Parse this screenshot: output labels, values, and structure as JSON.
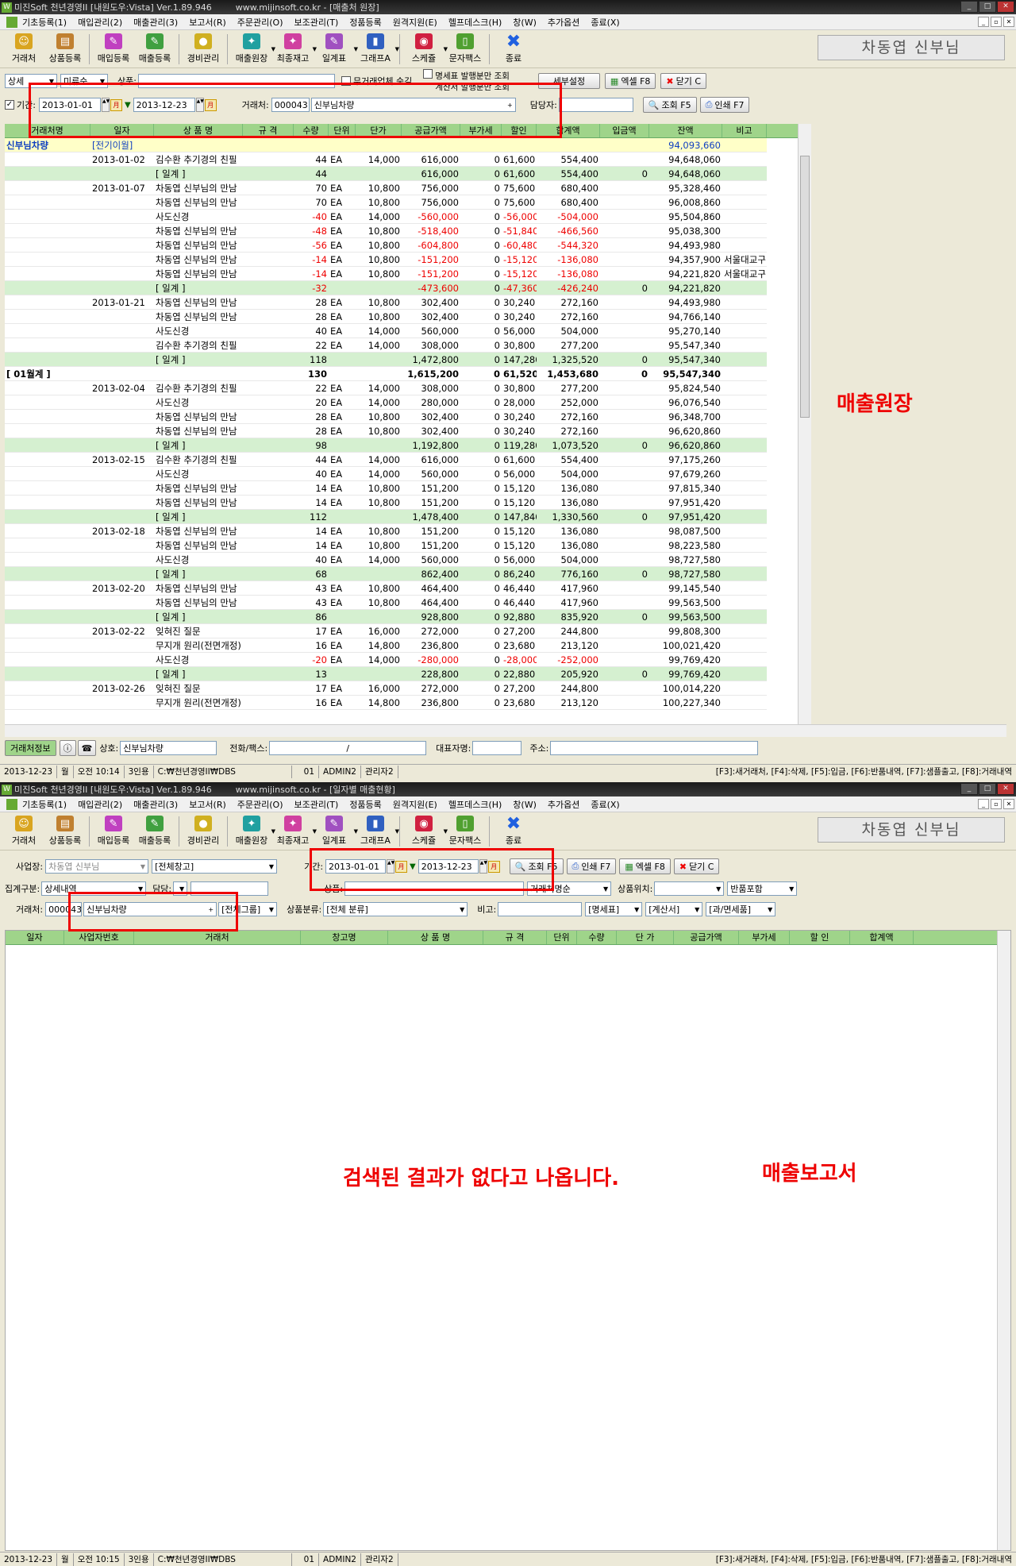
{
  "w1": {
    "title": "미진Soft 천년경영II [내원도우:Vista] Ver.1.89.946",
    "url": "www.mijinsoft.co.kr - [매출처 원장]",
    "menu": [
      "기초등록(1)",
      "매입관리(2)",
      "매출관리(3)",
      "보고서(R)",
      "주문관리(O)",
      "보조관리(T)",
      "정품등록",
      "원격지원(E)",
      "헬프데스크(H)",
      "창(W)",
      "추가옵션",
      "종료(X)"
    ],
    "toolbar": [
      "거래처",
      "상품등록",
      "매입등록",
      "매출등록",
      "경비관리",
      "매출원장",
      "최종재고",
      "일계표",
      "그래프A",
      "스케쥴",
      "문자팩스",
      "종료"
    ],
    "user": "차동엽 신부님",
    "row1": {
      "sel1": "상세",
      "sel2": "미류순",
      "product_label": "상품:",
      "cb1": "무거래업체 숨김",
      "cb2": "명세표 발행분만 조회",
      "cb3": "계산서 발행분만 조회",
      "btn_setup": "세부설정",
      "btn_excel": "엑셀 F8",
      "btn_close": "닫기 C"
    },
    "row2": {
      "period_label": "기간:",
      "date_from": "2013-01-01",
      "date_to": "2013-12-23",
      "client_label": "거래처:",
      "client_code": "000043",
      "client_name": "신부님차량",
      "manager_label": "담당자:",
      "btn_query": "조회 F5",
      "btn_print": "인쇄 F7"
    },
    "cols": [
      "거래처명",
      "일자",
      "상 품 명",
      "규 격",
      "수량",
      "단위",
      "단가",
      "공급가액",
      "부가세",
      "할인",
      "합계액",
      "입금액",
      "잔액",
      "비고"
    ],
    "rows": [
      {
        "k": "carry",
        "c": [
          "신부님차량",
          "[전기이월]",
          "",
          "",
          "",
          "",
          "",
          "",
          "",
          "",
          "",
          "",
          "94,093,660",
          ""
        ]
      },
      {
        "k": "",
        "c": [
          "",
          "2013-01-02",
          "김수환 추기경의 친필",
          "",
          "44",
          "EA",
          "14,000",
          "616,000",
          "0",
          "61,600",
          "554,400",
          "",
          "94,648,060",
          ""
        ]
      },
      {
        "k": "sub",
        "c": [
          "",
          "",
          "[ 일계 ]",
          "",
          "44",
          "",
          "",
          "616,000",
          "0",
          "61,600",
          "554,400",
          "0",
          "94,648,060",
          ""
        ]
      },
      {
        "k": "",
        "c": [
          "",
          "2013-01-07",
          "차동엽 신부님의 만남",
          "",
          "70",
          "EA",
          "10,800",
          "756,000",
          "0",
          "75,600",
          "680,400",
          "",
          "95,328,460",
          ""
        ]
      },
      {
        "k": "",
        "c": [
          "",
          "",
          "차동엽 신부님의 만남",
          "",
          "70",
          "EA",
          "10,800",
          "756,000",
          "0",
          "75,600",
          "680,400",
          "",
          "96,008,860",
          ""
        ]
      },
      {
        "k": "",
        "c": [
          "",
          "",
          "사도신경",
          "",
          "-40",
          "EA",
          "14,000",
          "-560,000",
          "0",
          "-56,000",
          "-504,000",
          "",
          "95,504,860",
          ""
        ]
      },
      {
        "k": "",
        "c": [
          "",
          "",
          "차동엽 신부님의 만남",
          "",
          "-48",
          "EA",
          "10,800",
          "-518,400",
          "0",
          "-51,840",
          "-466,560",
          "",
          "95,038,300",
          ""
        ]
      },
      {
        "k": "",
        "c": [
          "",
          "",
          "차동엽 신부님의 만남",
          "",
          "-56",
          "EA",
          "10,800",
          "-604,800",
          "0",
          "-60,480",
          "-544,320",
          "",
          "94,493,980",
          ""
        ]
      },
      {
        "k": "",
        "c": [
          "",
          "",
          "차동엽 신부님의 만남",
          "",
          "-14",
          "EA",
          "10,800",
          "-151,200",
          "0",
          "-15,120",
          "-136,080",
          "",
          "94,357,900",
          "서울대교구"
        ]
      },
      {
        "k": "",
        "c": [
          "",
          "",
          "차동엽 신부님의 만남",
          "",
          "-14",
          "EA",
          "10,800",
          "-151,200",
          "0",
          "-15,120",
          "-136,080",
          "",
          "94,221,820",
          "서울대교구"
        ]
      },
      {
        "k": "sub",
        "c": [
          "",
          "",
          "[ 일계 ]",
          "",
          "-32",
          "",
          "",
          "-473,600",
          "0",
          "-47,360",
          "-426,240",
          "0",
          "94,221,820",
          ""
        ]
      },
      {
        "k": "",
        "c": [
          "",
          "2013-01-21",
          "차동엽 신부님의 만남",
          "",
          "28",
          "EA",
          "10,800",
          "302,400",
          "0",
          "30,240",
          "272,160",
          "",
          "94,493,980",
          ""
        ]
      },
      {
        "k": "",
        "c": [
          "",
          "",
          "차동엽 신부님의 만남",
          "",
          "28",
          "EA",
          "10,800",
          "302,400",
          "0",
          "30,240",
          "272,160",
          "",
          "94,766,140",
          ""
        ]
      },
      {
        "k": "",
        "c": [
          "",
          "",
          "사도신경",
          "",
          "40",
          "EA",
          "14,000",
          "560,000",
          "0",
          "56,000",
          "504,000",
          "",
          "95,270,140",
          ""
        ]
      },
      {
        "k": "",
        "c": [
          "",
          "",
          "김수환 추기경의 친필",
          "",
          "22",
          "EA",
          "14,000",
          "308,000",
          "0",
          "30,800",
          "277,200",
          "",
          "95,547,340",
          ""
        ]
      },
      {
        "k": "sub",
        "c": [
          "",
          "",
          "[ 일계 ]",
          "",
          "118",
          "",
          "",
          "1,472,800",
          "0",
          "147,280",
          "1,325,520",
          "0",
          "95,547,340",
          ""
        ]
      },
      {
        "k": "month",
        "c": [
          "[ 01월계 ]",
          "",
          "",
          "",
          "130",
          "",
          "",
          "1,615,200",
          "0",
          "61,520",
          "1,453,680",
          "0",
          "95,547,340",
          ""
        ]
      },
      {
        "k": "",
        "c": [
          "",
          "2013-02-04",
          "김수환 추기경의 친필",
          "",
          "22",
          "EA",
          "14,000",
          "308,000",
          "0",
          "30,800",
          "277,200",
          "",
          "95,824,540",
          ""
        ]
      },
      {
        "k": "",
        "c": [
          "",
          "",
          "사도신경",
          "",
          "20",
          "EA",
          "14,000",
          "280,000",
          "0",
          "28,000",
          "252,000",
          "",
          "96,076,540",
          ""
        ]
      },
      {
        "k": "",
        "c": [
          "",
          "",
          "차동엽 신부님의 만남",
          "",
          "28",
          "EA",
          "10,800",
          "302,400",
          "0",
          "30,240",
          "272,160",
          "",
          "96,348,700",
          ""
        ]
      },
      {
        "k": "",
        "c": [
          "",
          "",
          "차동엽 신부님의 만남",
          "",
          "28",
          "EA",
          "10,800",
          "302,400",
          "0",
          "30,240",
          "272,160",
          "",
          "96,620,860",
          ""
        ]
      },
      {
        "k": "sub",
        "c": [
          "",
          "",
          "[ 일계 ]",
          "",
          "98",
          "",
          "",
          "1,192,800",
          "0",
          "119,280",
          "1,073,520",
          "0",
          "96,620,860",
          ""
        ]
      },
      {
        "k": "",
        "c": [
          "",
          "2013-02-15",
          "김수환 추기경의 친필",
          "",
          "44",
          "EA",
          "14,000",
          "616,000",
          "0",
          "61,600",
          "554,400",
          "",
          "97,175,260",
          ""
        ]
      },
      {
        "k": "",
        "c": [
          "",
          "",
          "사도신경",
          "",
          "40",
          "EA",
          "14,000",
          "560,000",
          "0",
          "56,000",
          "504,000",
          "",
          "97,679,260",
          ""
        ]
      },
      {
        "k": "",
        "c": [
          "",
          "",
          "차동엽 신부님의 만남",
          "",
          "14",
          "EA",
          "10,800",
          "151,200",
          "0",
          "15,120",
          "136,080",
          "",
          "97,815,340",
          ""
        ]
      },
      {
        "k": "",
        "c": [
          "",
          "",
          "차동엽 신부님의 만남",
          "",
          "14",
          "EA",
          "10,800",
          "151,200",
          "0",
          "15,120",
          "136,080",
          "",
          "97,951,420",
          ""
        ]
      },
      {
        "k": "sub",
        "c": [
          "",
          "",
          "[ 일계 ]",
          "",
          "112",
          "",
          "",
          "1,478,400",
          "0",
          "147,840",
          "1,330,560",
          "0",
          "97,951,420",
          ""
        ]
      },
      {
        "k": "",
        "c": [
          "",
          "2013-02-18",
          "차동엽 신부님의 만남",
          "",
          "14",
          "EA",
          "10,800",
          "151,200",
          "0",
          "15,120",
          "136,080",
          "",
          "98,087,500",
          ""
        ]
      },
      {
        "k": "",
        "c": [
          "",
          "",
          "차동엽 신부님의 만남",
          "",
          "14",
          "EA",
          "10,800",
          "151,200",
          "0",
          "15,120",
          "136,080",
          "",
          "98,223,580",
          ""
        ]
      },
      {
        "k": "",
        "c": [
          "",
          "",
          "사도신경",
          "",
          "40",
          "EA",
          "14,000",
          "560,000",
          "0",
          "56,000",
          "504,000",
          "",
          "98,727,580",
          ""
        ]
      },
      {
        "k": "sub",
        "c": [
          "",
          "",
          "[ 일계 ]",
          "",
          "68",
          "",
          "",
          "862,400",
          "0",
          "86,240",
          "776,160",
          "0",
          "98,727,580",
          ""
        ]
      },
      {
        "k": "",
        "c": [
          "",
          "2013-02-20",
          "차동엽 신부님의 만남",
          "",
          "43",
          "EA",
          "10,800",
          "464,400",
          "0",
          "46,440",
          "417,960",
          "",
          "99,145,540",
          ""
        ]
      },
      {
        "k": "",
        "c": [
          "",
          "",
          "차동엽 신부님의 만남",
          "",
          "43",
          "EA",
          "10,800",
          "464,400",
          "0",
          "46,440",
          "417,960",
          "",
          "99,563,500",
          ""
        ]
      },
      {
        "k": "sub",
        "c": [
          "",
          "",
          "[ 일계 ]",
          "",
          "86",
          "",
          "",
          "928,800",
          "0",
          "92,880",
          "835,920",
          "0",
          "99,563,500",
          ""
        ]
      },
      {
        "k": "",
        "c": [
          "",
          "2013-02-22",
          "잊혀진 질문",
          "",
          "17",
          "EA",
          "16,000",
          "272,000",
          "0",
          "27,200",
          "244,800",
          "",
          "99,808,300",
          ""
        ]
      },
      {
        "k": "",
        "c": [
          "",
          "",
          "무지개 원리(전면개정)",
          "",
          "16",
          "EA",
          "14,800",
          "236,800",
          "0",
          "23,680",
          "213,120",
          "",
          "100,021,420",
          ""
        ]
      },
      {
        "k": "",
        "c": [
          "",
          "",
          "사도신경",
          "",
          "-20",
          "EA",
          "14,000",
          "-280,000",
          "0",
          "-28,000",
          "-252,000",
          "",
          "99,769,420",
          ""
        ]
      },
      {
        "k": "sub",
        "c": [
          "",
          "",
          "[ 일계 ]",
          "",
          "13",
          "",
          "",
          "228,800",
          "0",
          "22,880",
          "205,920",
          "0",
          "99,769,420",
          ""
        ]
      },
      {
        "k": "",
        "c": [
          "",
          "2013-02-26",
          "잊혀진 질문",
          "",
          "17",
          "EA",
          "16,000",
          "272,000",
          "0",
          "27,200",
          "244,800",
          "",
          "100,014,220",
          ""
        ]
      },
      {
        "k": "",
        "c": [
          "",
          "",
          "무지개 원리(전면개정)",
          "",
          "16",
          "EA",
          "14,800",
          "236,800",
          "0",
          "23,680",
          "213,120",
          "",
          "100,227,340",
          ""
        ]
      }
    ],
    "bottom": {
      "tab": "거래처정보",
      "shop_label": "상호:",
      "shop": "신부님차량",
      "tel_label": "전화/팩스:",
      "tel_sep": "/",
      "ceo_label": "대표자명:",
      "addr_label": "주소:"
    },
    "status": [
      "2013-12-23",
      "월",
      "오전 10:14",
      "3인용",
      "C:₩천년경영II₩DBS",
      "01",
      "ADMIN2",
      "관리자2",
      "[F3]:새거래처, [F4]:삭제, [F5]:입금, [F6]:반품내역, [F7]:샘플출고, [F8]:거래내역"
    ],
    "annot": "매출원장"
  },
  "w2": {
    "title": "미진Soft 천년경영II [내원도우:Vista] Ver.1.89.946",
    "url": "www.mijinsoft.co.kr - [일자별 매출현황]",
    "user": "차동엽 신부님",
    "r1": {
      "biz_label": "사업장:",
      "biz": "차동엽 신부님",
      "store": "[전체창고]",
      "period_label": "기간:",
      "date_from": "2013-01-01",
      "date_to": "2013-12-23",
      "btn_query": "조회 F5",
      "btn_print": "인쇄 F7",
      "btn_excel": "엑셀 F8",
      "btn_close": "닫기 C"
    },
    "r2": {
      "agg_label": "집계구분:",
      "agg": "상세내역",
      "mgr_label": "담당:",
      "prod_label": "상품:",
      "sort": "거래처명순",
      "loc_label": "상품위치:",
      "ret": "반품포함"
    },
    "r3": {
      "client_label": "거래처:",
      "client_code": "000043",
      "client_name": "신부님차량",
      "group": "[전체그룹]",
      "cat_label": "상품분류:",
      "cat": "[전체 분류]",
      "note_label": "비고:",
      "f1": "[명세표]",
      "f2": "[계산서]",
      "f3": "[과/면세품]"
    },
    "cols": [
      "일자",
      "사업자번호",
      "거래처",
      "창고명",
      "상 품 명",
      "규 격",
      "단위",
      "수량",
      "단 가",
      "공급가액",
      "부가세",
      "할 인",
      "합계액"
    ],
    "status": [
      "2013-12-23",
      "월",
      "오전 10:15",
      "3인용",
      "C:₩천년경영II₩DBS",
      "01",
      "ADMIN2",
      "관리자2",
      "[F3]:새거래처, [F4]:삭제, [F5]:입금, [F6]:반품내역, [F7]:샘플출고, [F8]:거래내역"
    ],
    "annot_msg": "검색된 결과가 없다고 나옵니다.",
    "annot_label": "매출보고서"
  },
  "colors": {
    "accent_red": "#e00000",
    "grid_header": "#9fd48a",
    "subtotal_row": "#d5f0d0",
    "carry_row": "#ffffc8"
  }
}
